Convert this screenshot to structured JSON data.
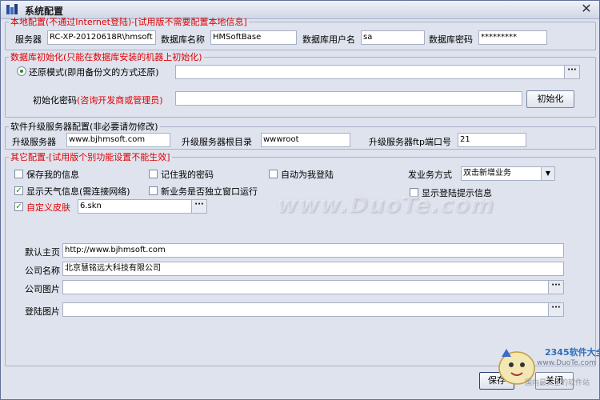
{
  "window": {
    "title": "系统配置",
    "close_glyph": "✕"
  },
  "local": {
    "legend_left": "本地配置",
    "legend_red": "(不通过Internet登陆)-[试用版不需要配置本地信息]",
    "server_label": "服务器",
    "server_value": "RC-XP-20120618R\\hmsoft",
    "dbname_label": "数据库名称",
    "dbname_value": "HMSoftBase",
    "dbuser_label": "数据库用户名",
    "dbuser_value": "sa",
    "dbpwd_label": "数据库密码",
    "dbpwd_value": "*********"
  },
  "dbinit": {
    "legend": "数据库初始化(只能在数据库安装的机器上初始化)",
    "restore_label": "还原模式(即用备份文的方式还原)",
    "restore_checked": true,
    "restore_value": "",
    "ellipsis": "···",
    "pwd_label": "初始化密码",
    "pwd_hint": "(咨询开发商或管理员)",
    "pwd_value": "",
    "init_button": "初始化"
  },
  "upgrade": {
    "legend": "软件升级服务器配置(非必要请勿修改)",
    "server_label": "升级服务器",
    "server_value": "www.bjhmsoft.com",
    "root_label": "升级服务器根目录",
    "root_value": "wwwroot",
    "port_label": "升级服务器ftp端口号",
    "port_value": "21"
  },
  "other": {
    "legend": "其它配置-[试用版个别功能设置不能生效]",
    "save_info": {
      "label": "保存我的信息",
      "checked": false
    },
    "remember_pwd": {
      "label": "记住我的密码",
      "checked": false
    },
    "auto_login": {
      "label": "自动为我登陆",
      "checked": false
    },
    "show_weather": {
      "label": "显示天气信息(需连接网络)",
      "checked": true
    },
    "new_window": {
      "label": "新业务是否独立窗口运行",
      "checked": false
    },
    "custom_skin": {
      "label": "自定义皮肤",
      "checked": true
    },
    "skin_value": "6.skn",
    "issue_label": "发业务方式",
    "issue_value": "双击新增业务",
    "show_login_tip": {
      "label": "显示登陆提示信息",
      "checked": false
    },
    "homepage_label": "默认主页",
    "homepage_value": "http://www.bjhmsoft.com",
    "company_label": "公司名称",
    "company_value": "北京慧铭远大科技有限公司",
    "company_pic_label": "公司图片",
    "company_pic_value": "",
    "login_pic_label": "登陆图片",
    "login_pic_value": ""
  },
  "buttons": {
    "save": "保存",
    "close": "关闭"
  },
  "watermark": {
    "site": "www.DuoTe.com",
    "brand": "2345软件大全",
    "url": "www.DuoTe.com",
    "sub": "国内最安全的软件站"
  },
  "colors": {
    "accent_red": "#e00000",
    "check_green": "#1f8f1f"
  },
  "icons": {
    "app": "app-icon",
    "close": "close-icon",
    "dropdown": "chevron-down-icon",
    "check": "checkmark-icon"
  }
}
